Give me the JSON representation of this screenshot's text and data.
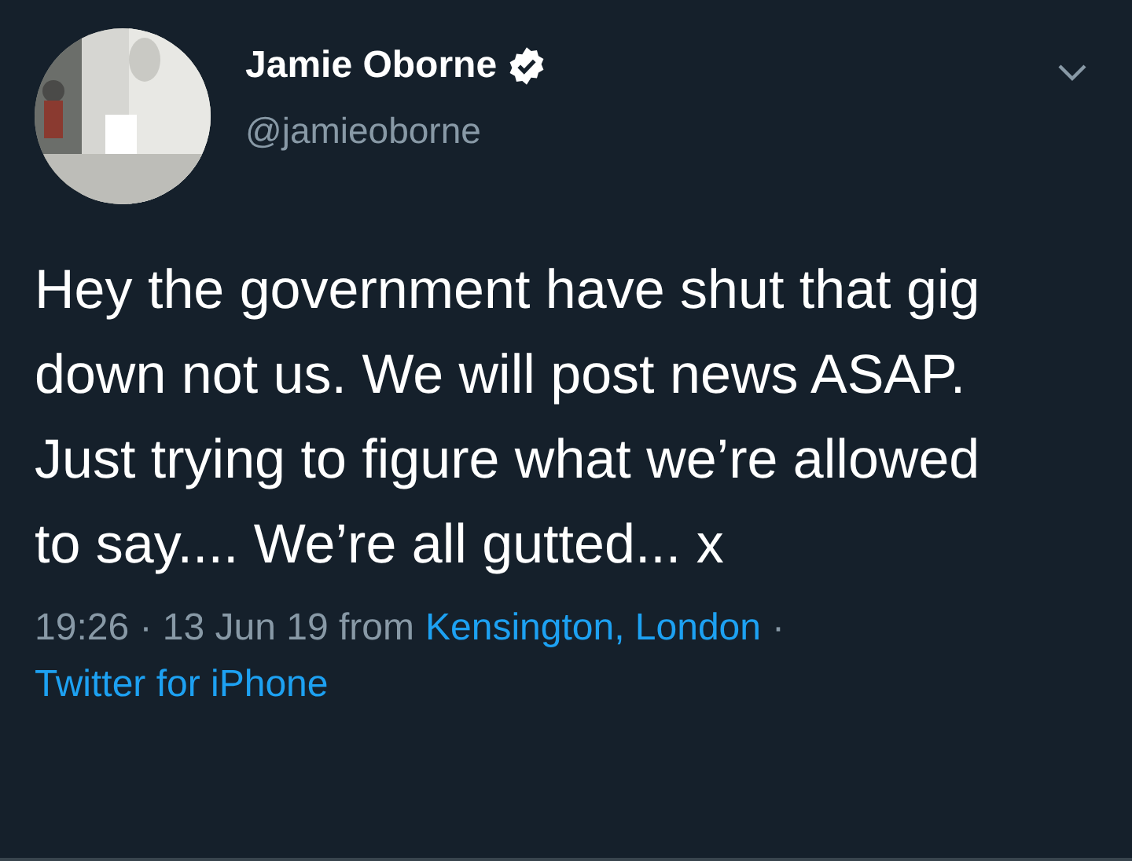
{
  "author": {
    "name": "Jamie Oborne",
    "verified": true,
    "handle": "@jamieoborne"
  },
  "text": "Hey the government have shut that gig down not us. We will post news ASAP. Just trying to figure what we’re allowed to say.... We’re all gutted... x",
  "meta": {
    "timestamp": "19:26 · 13 Jun 19 from",
    "location": "Kensington, London",
    "separator": "·",
    "source": "Twitter for iPhone"
  }
}
